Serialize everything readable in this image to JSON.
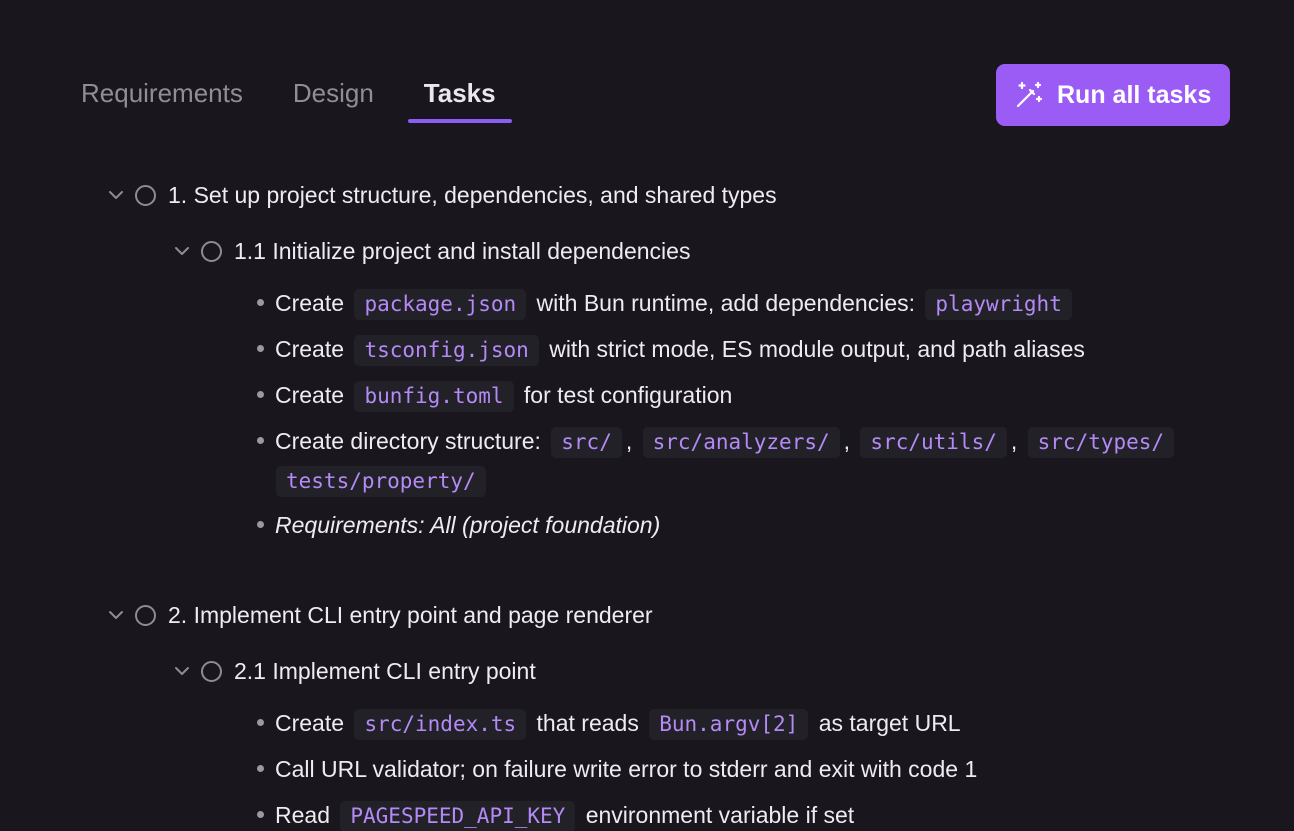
{
  "tabs": [
    {
      "label": "Requirements",
      "active": false
    },
    {
      "label": "Design",
      "active": false
    },
    {
      "label": "Tasks",
      "active": true
    }
  ],
  "run_button": {
    "label": "Run all tasks",
    "icon": "magic-wand-icon",
    "color": "#9b5cf6"
  },
  "accent_color": "#8b5cf6",
  "tasks": {
    "t1": {
      "label": "1. Set up project structure, dependencies, and shared types"
    },
    "t1_1": {
      "label": "1.1 Initialize project and install dependencies",
      "bullets": {
        "b1": {
          "pre": "Create",
          "code1": "package.json",
          "mid": "with Bun runtime, add dependencies:",
          "code2": "playwright"
        },
        "b2": {
          "pre": "Create",
          "code1": "tsconfig.json",
          "post": "with strict mode, ES module output, and path aliases"
        },
        "b3": {
          "pre": "Create",
          "code1": "bunfig.toml",
          "post": "for test configuration"
        },
        "b4": {
          "pre": "Create directory structure:",
          "code1": "src/",
          "sep1": ",",
          "code2": "src/analyzers/",
          "sep2": ",",
          "code3": "src/utils/",
          "sep3": ",",
          "code4": "src/types/",
          "code5": "tests/property/"
        },
        "b5": {
          "text": "Requirements: All (project foundation)"
        }
      }
    },
    "t2": {
      "label": "2. Implement CLI entry point and page renderer"
    },
    "t2_1": {
      "label": "2.1 Implement CLI entry point",
      "bullets": {
        "b1": {
          "pre": "Create",
          "code1": "src/index.ts",
          "mid": "that reads",
          "code2": "Bun.argv[2]",
          "post": "as target URL"
        },
        "b2": {
          "text": "Call URL validator; on failure write error to stderr and exit with code 1"
        },
        "b3": {
          "pre": "Read",
          "code1": "PAGESPEED_API_KEY",
          "post": "environment variable if set"
        }
      }
    }
  }
}
